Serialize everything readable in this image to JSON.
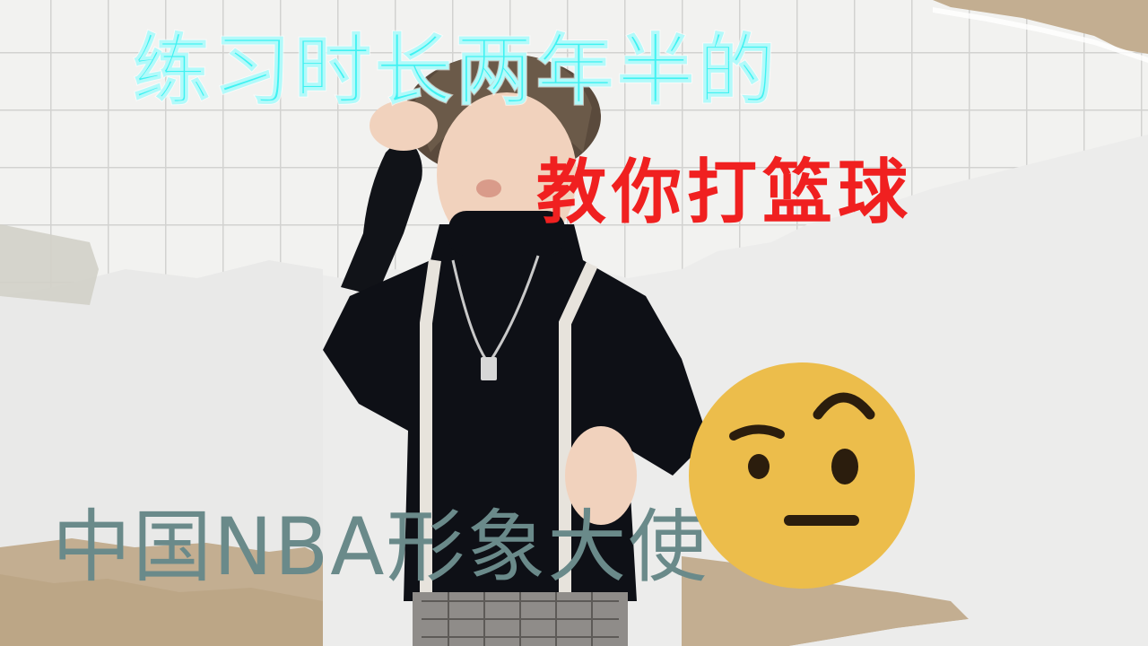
{
  "captions": {
    "top": "练习时长两年半的",
    "middle": "教你打篮球",
    "bottom": "中国NBA形象大使"
  },
  "colors": {
    "top_caption": "#3ff2f2",
    "middle_caption": "#f02020",
    "bottom_caption": "#6a8a8a",
    "emoji_face": "#ecbd4b",
    "emoji_features": "#2b1d0d",
    "torn_paper": "#c3ae91"
  },
  "icons": {
    "emoji": "face-with-raised-eyebrow-icon"
  }
}
